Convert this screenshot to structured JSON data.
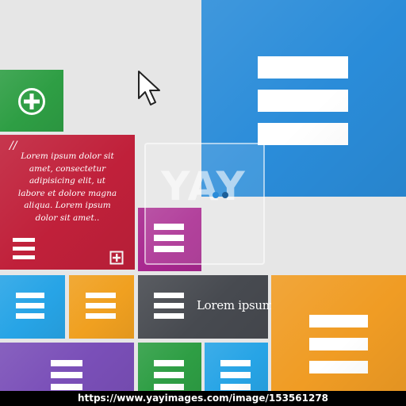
{
  "colors": {
    "background": "#e6e6e6",
    "blue": "#2a8cd9",
    "green": "#2e9e44",
    "red": "#c0203a",
    "magenta": "#a8278f",
    "light_blue": "#27a4e6",
    "orange": "#f0a020",
    "dark_gray": "#474a50",
    "big_orange": "#f09c24",
    "purple": "#7a4fb8"
  },
  "tiles": {
    "big_blue": {
      "icon": "menu-icon"
    },
    "green_add": {
      "icon": "plus-circle-icon"
    },
    "red_text": {
      "quote_mark": "//",
      "text_lines": [
        "Lorem ipsum dolor sit",
        "amet, consectetur",
        "adipisicing elit, ut",
        "labore et dolore magna",
        "aliqua. Lorem ipsum",
        "dolor sit amet.."
      ],
      "menu_icon": "menu-icon",
      "add_icon": "plus-square-icon"
    },
    "magenta": {
      "icon": "menu-icon"
    },
    "light_blue": {
      "icon": "menu-icon"
    },
    "orange": {
      "icon": "menu-icon"
    },
    "dark_gray": {
      "icon": "menu-icon",
      "caption": "Lorem ipsum"
    },
    "big_orange": {
      "icon": "menu-icon"
    },
    "purple": {
      "icon": "menu-icon"
    },
    "green_bottom": {
      "icon": "menu-icon"
    },
    "blue_bottom": {
      "icon": "menu-icon"
    }
  },
  "cursor": {
    "icon": "mouse-pointer-icon"
  },
  "watermark": {
    "text": "YAY"
  },
  "footer": {
    "url": "https://www.yayimages.com/image/153561278"
  }
}
